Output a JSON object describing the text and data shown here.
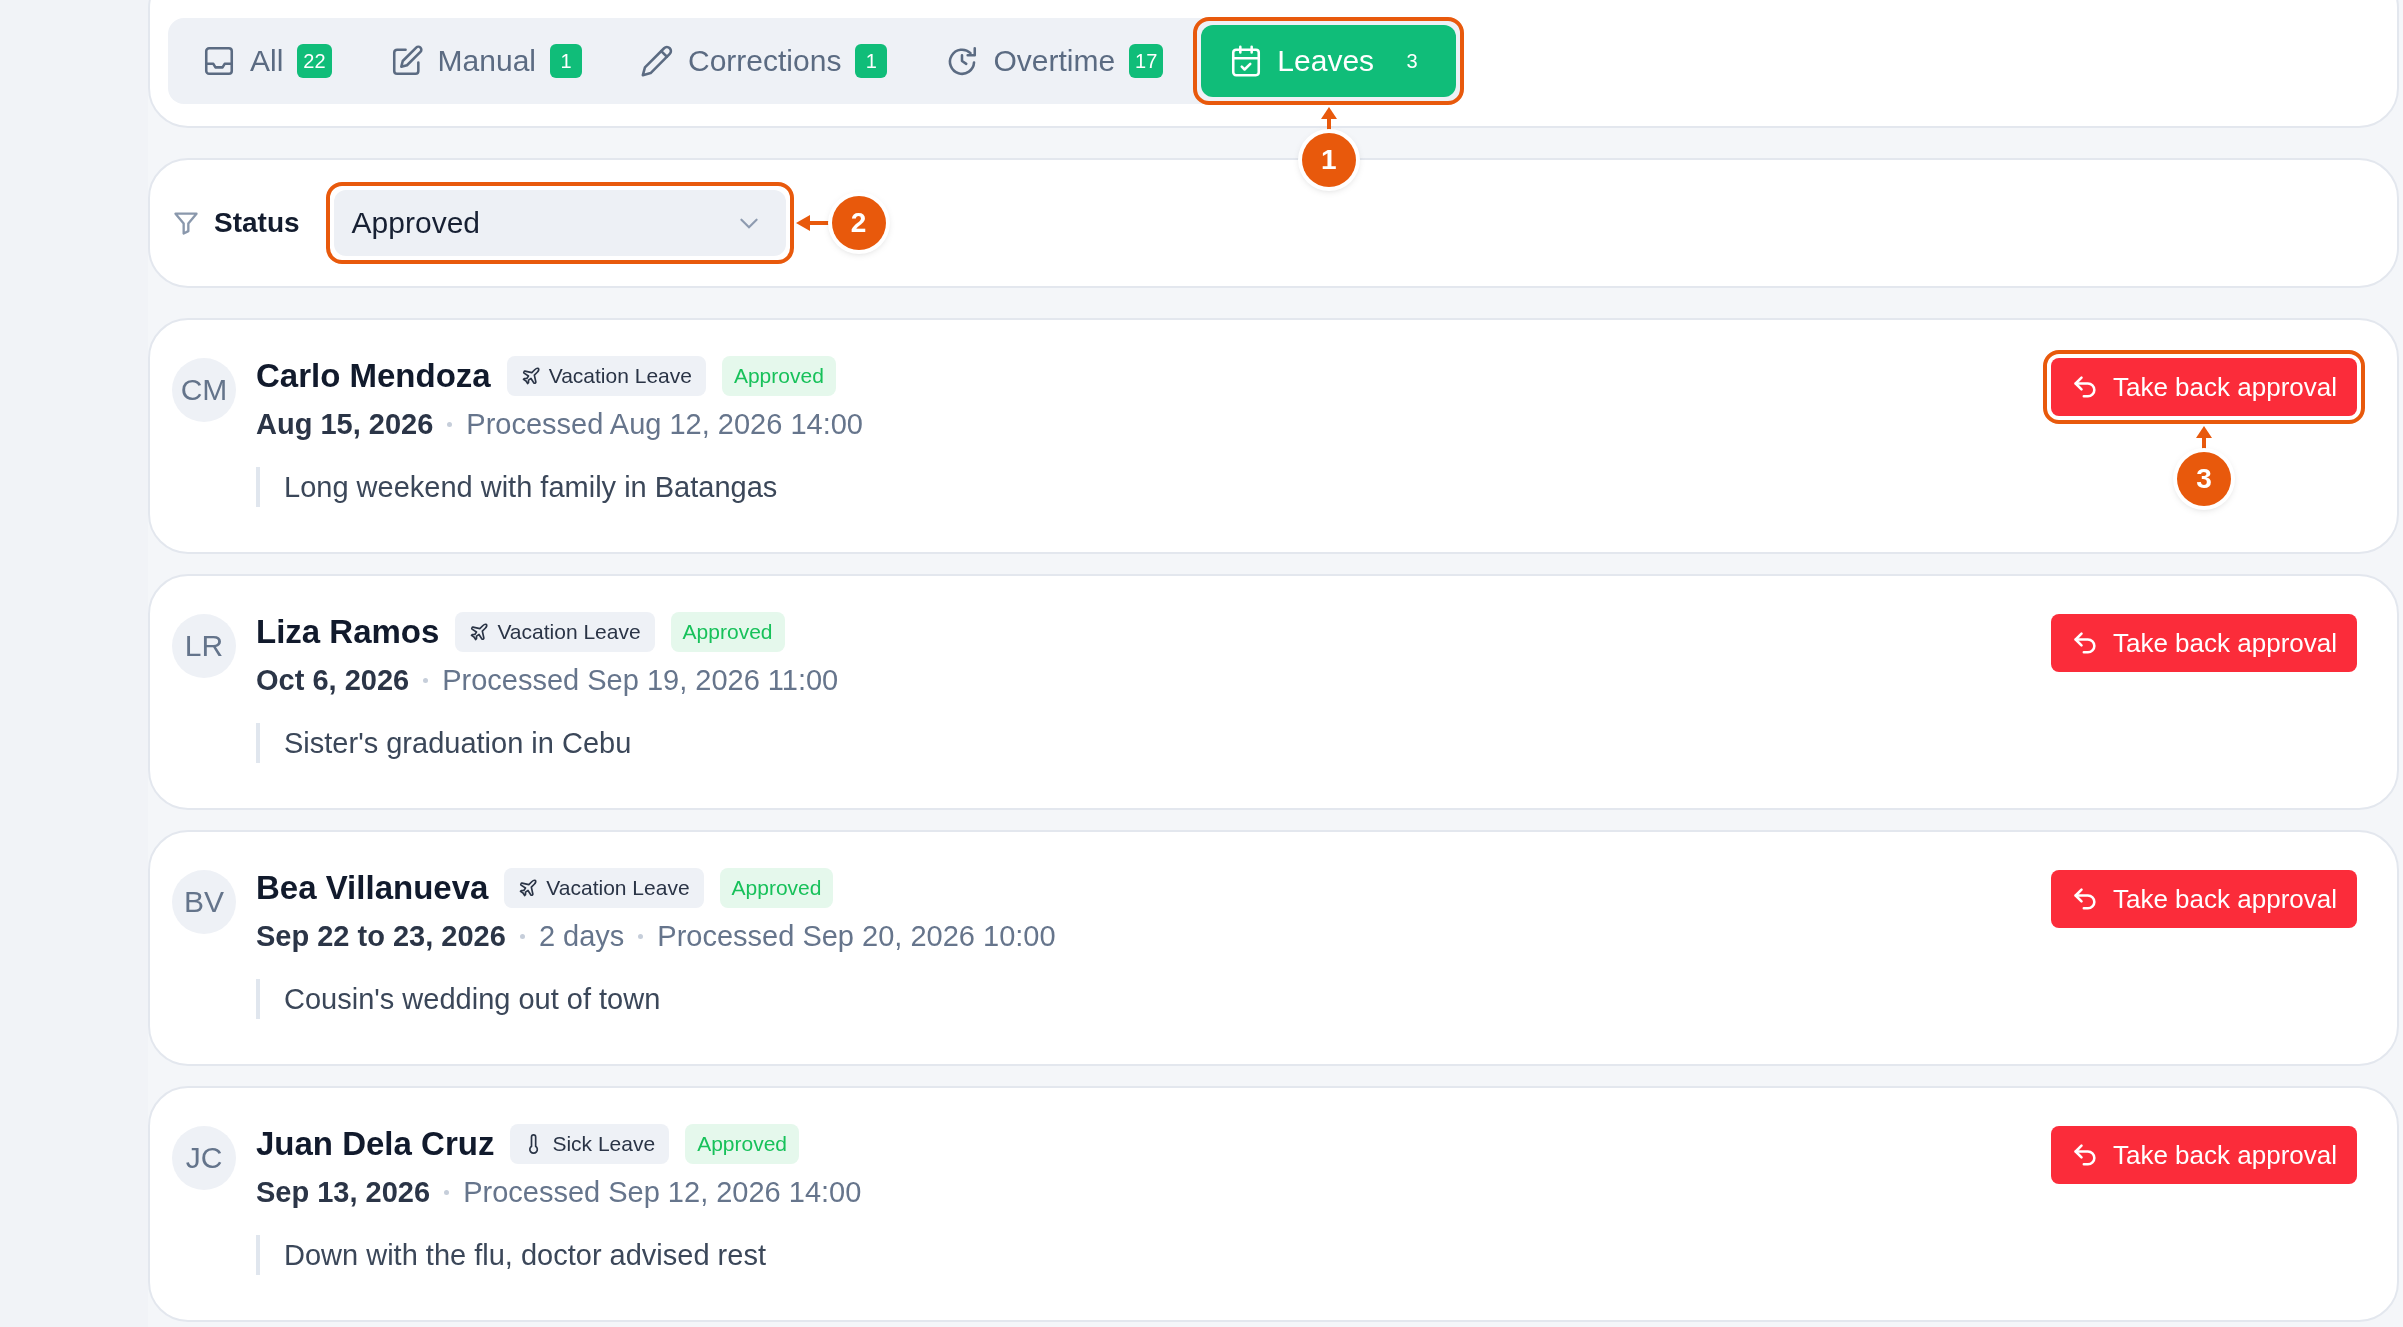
{
  "tabs": [
    {
      "label": "All",
      "count": "22",
      "kind": "inbox",
      "selected": false
    },
    {
      "label": "Manual",
      "count": "1",
      "kind": "edit",
      "selected": false
    },
    {
      "label": "Corrections",
      "count": "1",
      "kind": "pencil",
      "selected": false
    },
    {
      "label": "Overtime",
      "count": "17",
      "kind": "clock",
      "selected": false
    },
    {
      "label": "Leaves",
      "count": "3",
      "kind": "calendar",
      "selected": true,
      "callout": "1"
    }
  ],
  "filter": {
    "label": "Status",
    "value": "Approved",
    "callout": "2"
  },
  "requests": [
    {
      "initials": "CM",
      "name": "Carlo Mendoza",
      "leave_type": {
        "label": "Vacation Leave",
        "kind": "plane"
      },
      "status": "Approved",
      "date": "Aug 15, 2026",
      "details": [
        "Processed Aug 12, 2026 14:00"
      ],
      "note": "Long weekend with family in Batangas",
      "action": "Take back approval",
      "callout": "3"
    },
    {
      "initials": "LR",
      "name": "Liza Ramos",
      "leave_type": {
        "label": "Vacation Leave",
        "kind": "plane"
      },
      "status": "Approved",
      "date": "Oct 6, 2026",
      "details": [
        "Processed Sep 19, 2026 11:00"
      ],
      "note": "Sister's graduation in Cebu",
      "action": "Take back approval"
    },
    {
      "initials": "BV",
      "name": "Bea Villanueva",
      "leave_type": {
        "label": "Vacation Leave",
        "kind": "plane"
      },
      "status": "Approved",
      "date": "Sep 22 to 23, 2026",
      "details": [
        "2 days",
        "Processed Sep 20, 2026 10:00"
      ],
      "note": "Cousin's wedding out of town",
      "action": "Take back approval"
    },
    {
      "initials": "JC",
      "name": "Juan Dela Cruz",
      "leave_type": {
        "label": "Sick Leave",
        "kind": "thermometer"
      },
      "status": "Approved",
      "date": "Sep 13, 2026",
      "details": [
        "Processed Sep 12, 2026 14:00"
      ],
      "note": "Down with the flu, doctor advised rest",
      "action": "Take back approval"
    }
  ]
}
